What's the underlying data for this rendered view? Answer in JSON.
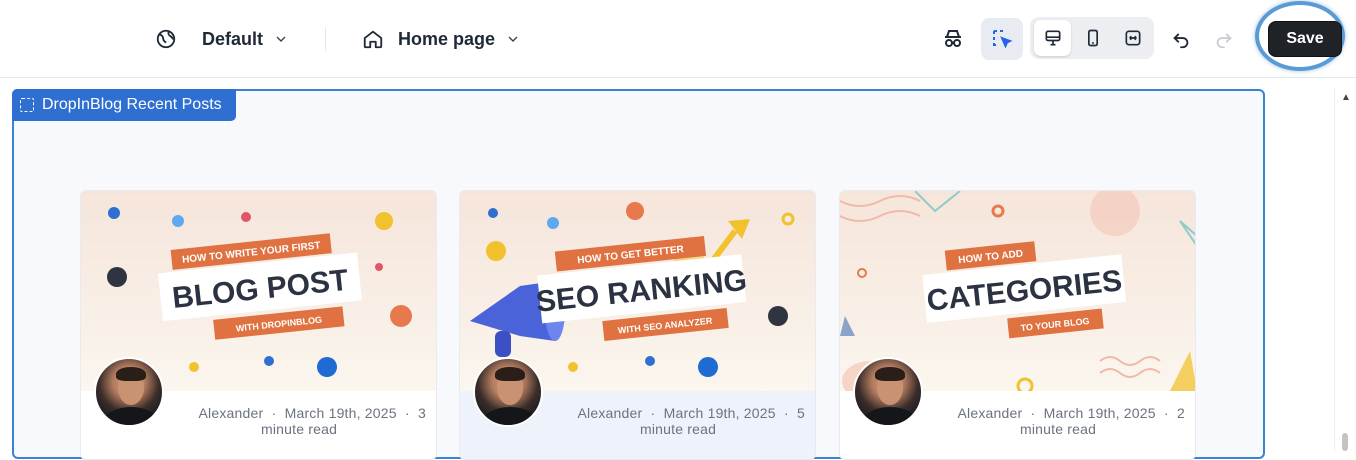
{
  "toolbar": {
    "language_label": "Default",
    "page_label": "Home page",
    "save_label": "Save"
  },
  "section": {
    "tag_label": "DropInBlog Recent Posts"
  },
  "posts": [
    {
      "banner_top": "HOW TO WRITE YOUR FIRST",
      "banner_main": "BLOG POST",
      "banner_bottom": "WITH DROPINBLOG",
      "author": "Alexander",
      "date": "March 19th, 2025",
      "read_line1": "3",
      "read_line2": "minute read"
    },
    {
      "banner_top": "HOW TO GET BETTER",
      "banner_main": "SEO RANKING",
      "banner_bottom": "WITH SEO ANALYZER",
      "author": "Alexander",
      "date": "March 19th, 2025",
      "read_line1": "5",
      "read_line2": "minute read"
    },
    {
      "banner_top": "HOW TO ADD",
      "banner_main": "CATEGORIES",
      "banner_bottom": "TO YOUR BLOG",
      "author": "Alexander",
      "date": "March 19th, 2025",
      "read_line1": "2",
      "read_line2": "minute read"
    }
  ],
  "colors": {
    "accent": "#2f6fd1",
    "highlight_ring": "#5b9bd5",
    "save_bg": "#1f2327",
    "banner_orange": "#e07242",
    "banner_text_dark": "#2b3242"
  },
  "icons": {
    "language": "globe-icon",
    "page": "home-icon",
    "chevron": "chevron-down-icon",
    "preview": "incognito-icon",
    "select": "dashed-cursor-icon",
    "desktop": "monitor-icon",
    "mobile": "phone-icon",
    "fullwidth": "expand-width-icon",
    "undo": "undo-icon",
    "redo": "redo-icon"
  }
}
